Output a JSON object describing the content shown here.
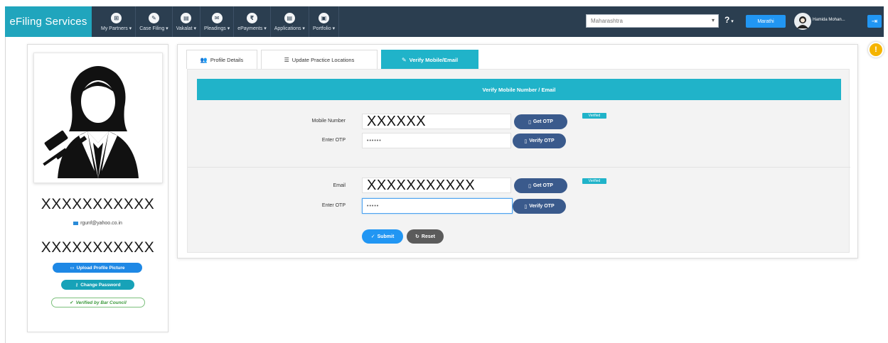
{
  "navbar": {
    "brand": "eFiling Services",
    "menu": [
      {
        "label": "My Partners",
        "icon": "partners-icon",
        "glyph": "⊞"
      },
      {
        "label": "Case Filing",
        "icon": "pencil-icon",
        "glyph": "✎"
      },
      {
        "label": "Vakalat",
        "icon": "document-icon",
        "glyph": "▤"
      },
      {
        "label": "Pleadings",
        "icon": "inbox-icon",
        "glyph": "✉"
      },
      {
        "label": "ePayments",
        "icon": "rupee-icon",
        "glyph": "₹"
      },
      {
        "label": "Applications",
        "icon": "file-icon",
        "glyph": "▤"
      },
      {
        "label": "Portfolio",
        "icon": "briefcase-icon",
        "glyph": "▣"
      }
    ],
    "state_select": "Maharashtra",
    "help": "?",
    "language_button": "Marathi",
    "user_name": "Hamida Mohan...",
    "logout_icon": "logout-icon"
  },
  "profile": {
    "name": "XXXXXXXXXXX",
    "email": "rgunf@yahoo.co.in",
    "id": "XXXXXXXXXXX",
    "upload_label": "Upload Profile Picture",
    "change_password_label": "Change Password",
    "verified_label": "Verified by Bar Council"
  },
  "tabs": [
    {
      "label": "Profile Details",
      "icon": "user-group-icon",
      "glyph": "👥"
    },
    {
      "label": "Update Practice Locations",
      "icon": "list-icon",
      "glyph": "☰"
    },
    {
      "label": "Verify Mobile/Email",
      "icon": "pencil-icon",
      "glyph": "✎",
      "active": true
    }
  ],
  "verify": {
    "header": "Verify Mobile Number / Email",
    "mobile_label": "Mobile Number",
    "mobile_value": "XXXXXX",
    "mobile_otp_label": "Enter OTP",
    "mobile_otp_value": "••••••",
    "email_label": "Email",
    "email_value": "XXXXXXXXXXX",
    "email_otp_label": "Enter OTP",
    "email_otp_value": "•••••",
    "get_otp": "Get OTP",
    "verify_otp": "Verify OTP",
    "verified_badge": "Verified",
    "submit": "Submit",
    "reset": "Reset"
  },
  "colors": {
    "navbar": "#2b3e50",
    "brand": "#20a5bd",
    "accent": "#20b3c9",
    "primary": "#2196f3",
    "otp_button": "#3a5a8c"
  }
}
